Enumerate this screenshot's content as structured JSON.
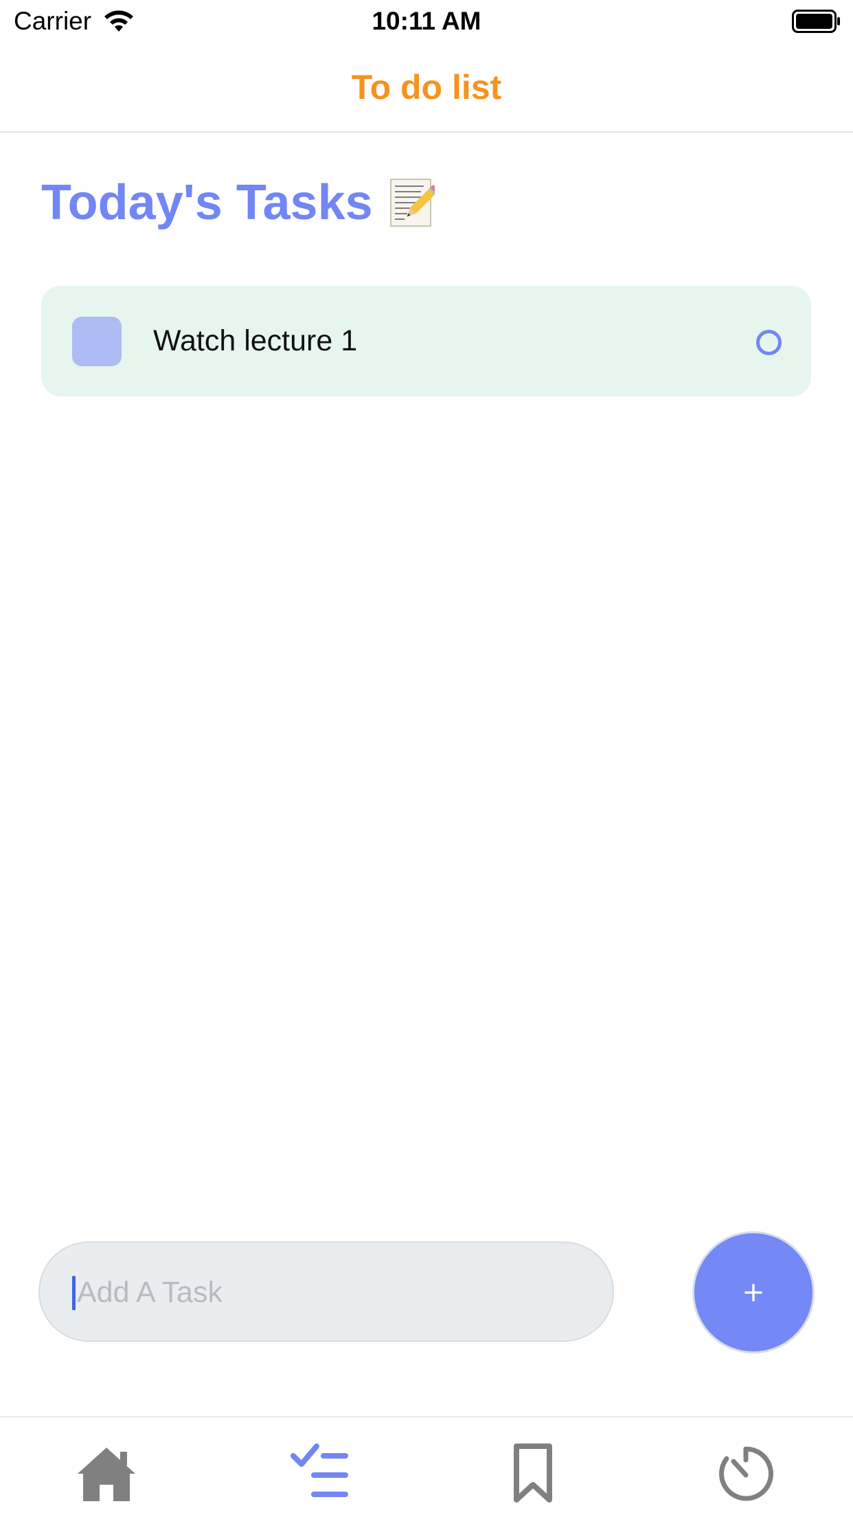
{
  "status_bar": {
    "carrier": "Carrier",
    "time": "10:11 AM"
  },
  "header": {
    "title": "To do list",
    "title_color": "#f6931f"
  },
  "section": {
    "title": "Today's Tasks"
  },
  "tasks": [
    {
      "label": "Watch lecture 1",
      "checkbox_color": "#aebcf5",
      "card_color": "#e7f5ef"
    }
  ],
  "task_input": {
    "value": "",
    "placeholder": "Add A Task"
  },
  "add_button": {
    "label": "+",
    "color": "#7489f6"
  },
  "tab_bar": {
    "tabs": [
      {
        "icon": "home-icon",
        "active": false
      },
      {
        "icon": "tasks-checklist-icon",
        "active": true
      },
      {
        "icon": "bookmark-icon",
        "active": false
      },
      {
        "icon": "timer-icon",
        "active": false
      }
    ],
    "active_color": "#7286f4",
    "inactive_color": "#808080"
  },
  "colors": {
    "accent": "#7286f4"
  }
}
